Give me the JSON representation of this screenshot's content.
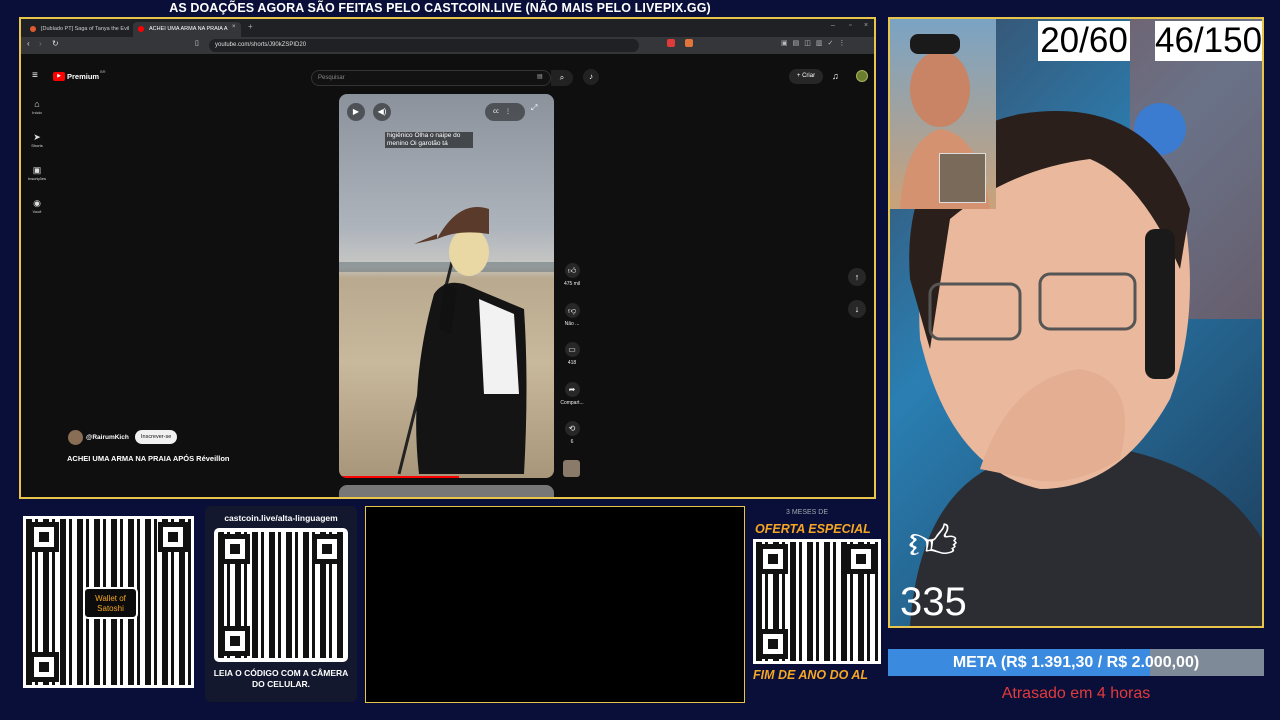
{
  "banner": "AS DOAÇÕES AGORA SÃO FEITAS PELO CASTCOIN.LIVE (NÃO MAIS PELO LIVEPIX.GG)",
  "browser": {
    "tab1": "[Dublado PT] Saga of Tanya the Evil",
    "tab2": "ACHEI UMA ARMA NA PRAIA A",
    "url": "youtube.com/shorts/J90kZSPID20"
  },
  "youtube": {
    "logo": "Premium",
    "logo_sup": "BR",
    "search_placeholder": "Pesquisar",
    "create": "Criar",
    "sidebar": [
      {
        "icon": "home-icon",
        "glyph": "⌂",
        "label": "Início"
      },
      {
        "icon": "shorts-icon",
        "glyph": "➤",
        "label": "Shorts"
      },
      {
        "icon": "subscriptions-icon",
        "glyph": "▣",
        "label": "Inscrições"
      },
      {
        "icon": "you-icon",
        "glyph": "◉",
        "label": "Você"
      }
    ],
    "caption": "higiênico Olha o naipe do menino Oi garotão tá",
    "channel": "@RairumKich",
    "subscribe": "Inscrever-se",
    "video_title": "ACHEI UMA ARMA NA PRAIA APÓS Réveillon",
    "likes": "475 mil",
    "dislike": "Não ...",
    "comments": "418",
    "share": "Compart...",
    "remix": "6"
  },
  "overlay": {
    "counter1": "20/60",
    "counter2": "46/150",
    "likes_count": "335",
    "meta": "META (R$ 1.391,30 / R$ 2.000,00)",
    "meta_progress": 0.6957,
    "status": "Atrasado em 4 horas",
    "qr1_label": "Wallet of Satoshi",
    "qr2_url": "castcoin.live/alta-linguagem",
    "qr2_caption": "LEIA O CÓDIGO COM A CÂMERA DO CELULAR.",
    "offer_top": "3 MESES DE",
    "offer_title": "OFERTA ESPECIAL",
    "offer_bottom": "FIM DE ANO DO AL"
  },
  "colors": {
    "accent": "#e8c44a",
    "meta_bar": "#3a8be0",
    "status": "#e23a3a",
    "yt_red": "#ff0000"
  }
}
